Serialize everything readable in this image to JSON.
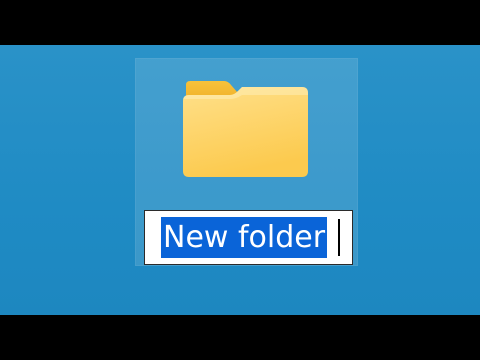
{
  "desktop": {
    "item": {
      "name": "New folder",
      "icon": "folder-icon",
      "state": "renaming",
      "selected": true
    }
  },
  "colors": {
    "desktop_background": "#1f8bc4",
    "selection_highlight": "#0a64d8",
    "folder_front": "#ffd86b",
    "folder_back": "#f5b82d"
  }
}
